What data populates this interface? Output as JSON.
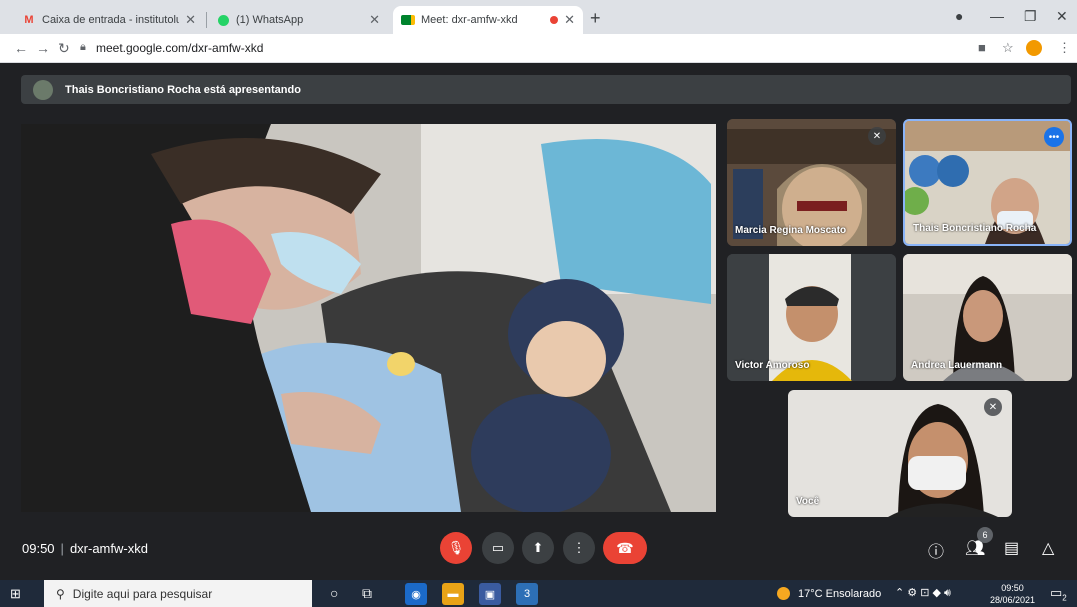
{
  "browser": {
    "tabs": [
      {
        "icon": "gmail-icon",
        "title": "Caixa de entrada - institutolucas"
      },
      {
        "icon": "whatsapp-icon",
        "title": "(1) WhatsApp"
      },
      {
        "icon": "meet-icon",
        "title": "Meet: dxr-amfw-xkd"
      }
    ],
    "new_tab": "+",
    "url": "meet.google.com/dxr-amfw-xkd"
  },
  "meet": {
    "presenting_banner": "Thais Boncristiano Rocha está apresentando",
    "participants": [
      {
        "name": "Marcia Regina Moscato",
        "muted": true
      },
      {
        "name": "Thais Boncristiano Rocha",
        "muted": false
      },
      {
        "name": "Victor Amoroso",
        "muted": false
      },
      {
        "name": "Andrea Lauermann",
        "muted": false
      },
      {
        "name": "Você",
        "muted": true
      }
    ],
    "time": "09:50",
    "meeting_code": "dxr-amfw-xkd",
    "people_count": "6"
  },
  "taskbar": {
    "search_placeholder": "Digite aqui para pesquisar",
    "app_badge": "3",
    "weather": "17°C  Ensolarado",
    "clock_time": "09:50",
    "clock_date": "28/06/2021",
    "notif_count": "2"
  },
  "colors": {
    "meet_bg": "#202124",
    "end_call": "#ea4335",
    "highlight": "#8ab4f8"
  }
}
